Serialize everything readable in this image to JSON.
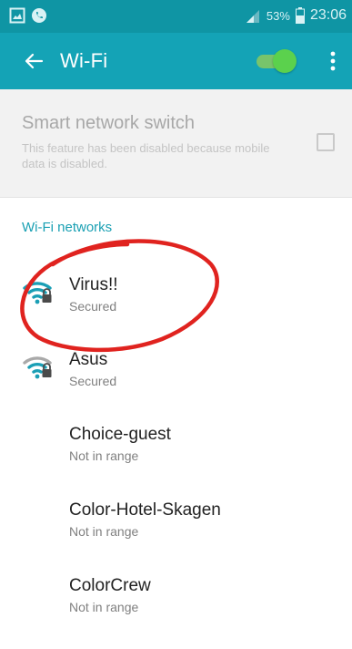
{
  "status_bar": {
    "battery_percent": "53%",
    "time": "23:06"
  },
  "toolbar": {
    "title": "Wi-Fi",
    "wifi_enabled": true
  },
  "smart_network": {
    "title": "Smart network switch",
    "description": "This feature has been disabled because mobile data is disabled.",
    "checked": false
  },
  "wifi_networks": {
    "header": "Wi-Fi networks",
    "items": [
      {
        "name": "Virus!!",
        "status": "Secured",
        "icon": "wifi-secured-icon"
      },
      {
        "name": "Asus",
        "status": "Secured",
        "icon": "wifi-secured-icon"
      },
      {
        "name": "Choice-guest",
        "status": "Not in range",
        "icon": ""
      },
      {
        "name": "Color-Hotel-Skagen",
        "status": "Not in range",
        "icon": ""
      },
      {
        "name": "ColorCrew",
        "status": "Not in range",
        "icon": ""
      }
    ]
  },
  "annotation": {
    "color": "#e0231f"
  },
  "colors": {
    "toolbar": "#14a3b6",
    "status_bar": "#0f95a4",
    "accent": "#1aa0b3",
    "switch_on": "#5bd14d"
  }
}
